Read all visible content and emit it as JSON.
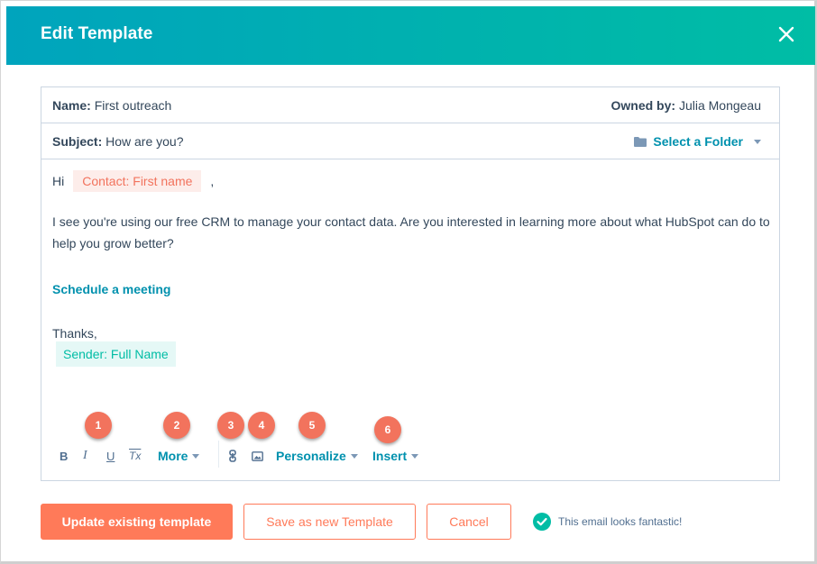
{
  "modal": {
    "title": "Edit Template",
    "close_icon": "close-icon",
    "header_gradient": [
      "#00a4bd",
      "#00bda5"
    ]
  },
  "fields": {
    "name_label": "Name:",
    "name_value": "First outreach",
    "owner_label": "Owned by:",
    "owner_value": "Julia Mongeau",
    "subject_label": "Subject:",
    "subject_value": "How are you?",
    "folder_label": "Select a Folder",
    "folder_icon": "folder-icon"
  },
  "body": {
    "greeting": "Hi",
    "contact_token": "Contact: First name",
    "greeting_comma": ",",
    "paragraph": "I see you're using our free CRM to manage your contact data. Are you interested in learning more about what HubSpot can do to help you grow better?",
    "meeting_link": "Schedule a meeting",
    "signoff": "Thanks,",
    "sender_token": "Sender: Full Name"
  },
  "toolbar": {
    "bold": "B",
    "italic": "I",
    "underline": "U",
    "clear_format": "Tx",
    "more": "More",
    "link_icon": "link-icon",
    "image_icon": "image-icon",
    "personalize": "Personalize",
    "insert": "Insert"
  },
  "callouts": [
    "1",
    "2",
    "3",
    "4",
    "5",
    "6"
  ],
  "footer": {
    "update_button": "Update existing template",
    "save_new_button": "Save as new Template",
    "cancel_button": "Cancel",
    "status_text": "This email looks fantastic!",
    "status_icon": "check-circle-icon"
  },
  "colors": {
    "accent_orange": "#ff7a59",
    "link_teal": "#0091ae",
    "success_green": "#00bda5",
    "text_dark": "#33475b"
  }
}
